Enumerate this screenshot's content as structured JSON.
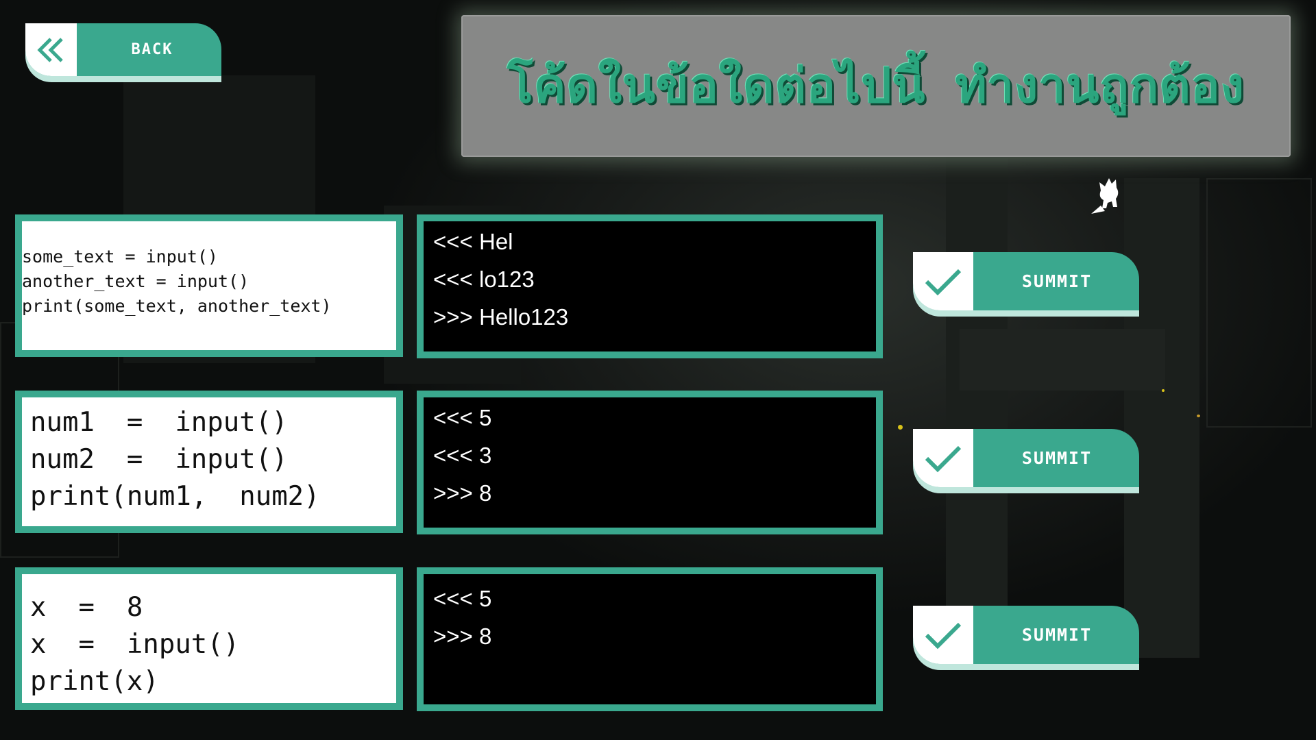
{
  "colors": {
    "accent": "#3aa88e",
    "accent_light": "#bfe6dc",
    "title_text": "#2ba57e",
    "title_panel": "#878887",
    "background": "#0a0c0b"
  },
  "header": {
    "back_label": "BACK",
    "back_icon": "double-chevron-left-icon",
    "title": "โค้ดในข้อใดต่อไปนี้ ทำงานถูกต้อง"
  },
  "questions": [
    {
      "code": "some_text = input()\nanother_text = input()\nprint(some_text, another_text)",
      "output": [
        "<<< Hel",
        "<<< lo123",
        ">>> Hello123"
      ],
      "submit_label": "SUMMIT",
      "submit_icon": "checkmark-icon"
    },
    {
      "code": "num1  =  input()\nnum2  =  input()\nprint(num1,  num2)",
      "output": [
        "<<< 5",
        "<<< 3",
        ">>> 8"
      ],
      "submit_label": "SUMMIT",
      "submit_icon": "checkmark-icon"
    },
    {
      "code": "x  =  8\nx  =  input()\nprint(x)",
      "output": [
        "<<< 5",
        ">>> 8"
      ],
      "submit_label": "SUMMIT",
      "submit_icon": "checkmark-icon"
    }
  ]
}
